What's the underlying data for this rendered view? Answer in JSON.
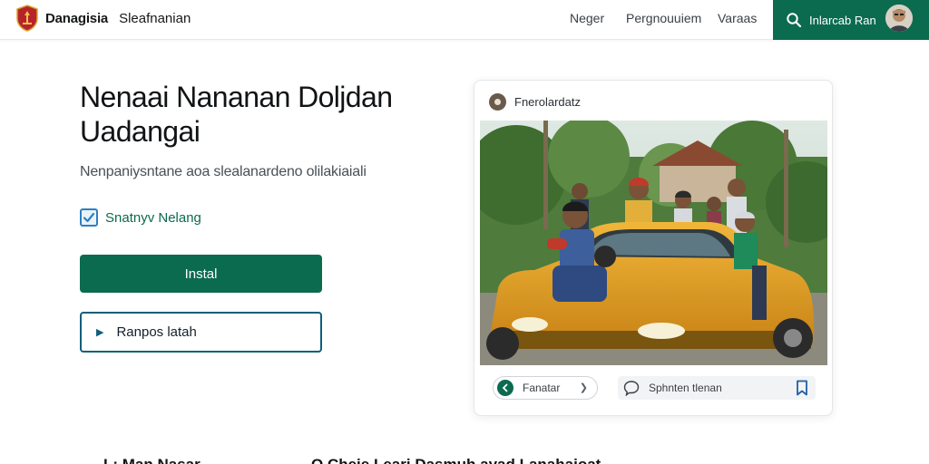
{
  "header": {
    "brand_name": "Danagisia",
    "brand_sub": "Sleafnanian",
    "nav": [
      "Neger",
      "Pergnouuiem",
      "Varaas"
    ],
    "account_label": "Inlarcab Ran",
    "accent_color": "#0b6b4f"
  },
  "hero": {
    "title": "Nenaai Nananan Doljdan Uadangai",
    "subtitle": "Nenpaniysntane aoa slealanardeno olilakiaiali",
    "checkbox_label": "Snatnyv Nelang",
    "checkbox_checked": true,
    "primary_button": "Instal",
    "secondary_button": "Ranpos latah"
  },
  "post_card": {
    "title": "Fnerolardatz",
    "reaction_label": "Fanatar",
    "comment_placeholder": "Sphnten tlenan"
  },
  "bottom": {
    "left_text": "L: Man Nasar",
    "right_text": "O Cheie Leari Dasmuh ayad Lanahaioat"
  },
  "icons": [
    "logo-shield-icon",
    "search-icon",
    "avatar",
    "check-icon",
    "chevron-right-icon",
    "play-icon",
    "comment-icon",
    "bookmark-icon"
  ]
}
